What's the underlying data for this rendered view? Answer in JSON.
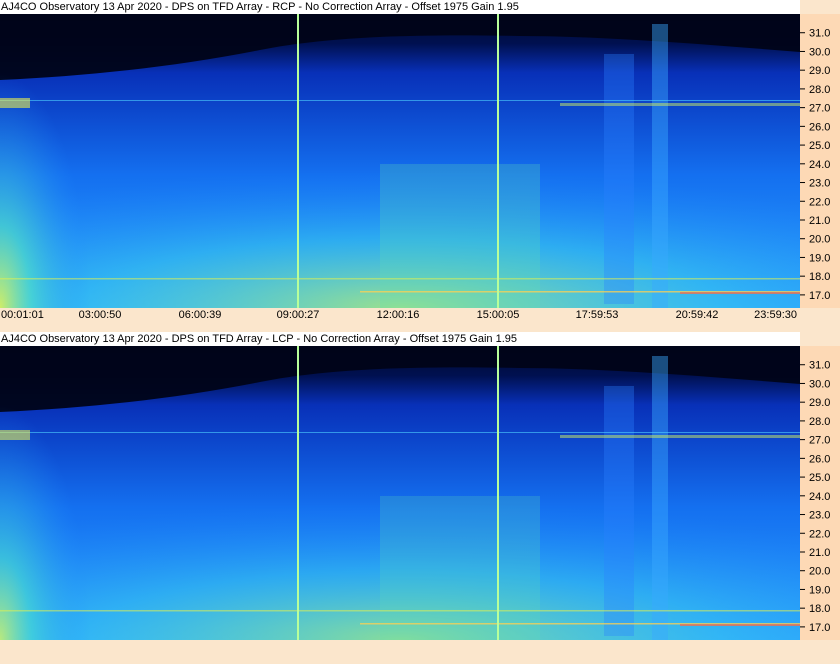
{
  "chart_data": [
    {
      "type": "heatmap",
      "title": "AJ4CO Observatory 13 Apr 2020 - DPS on TFD Array  - RCP  -  No Correction Array  -  Offset 1975  Gain 1.95",
      "x_tick_labels": [
        "00:01:01",
        "03:00:50",
        "06:00:39",
        "09:00:27",
        "12:00:16",
        "15:00:05",
        "17:59:53",
        "20:59:42",
        "23:59:30"
      ],
      "y_tick_labels": [
        "31.0",
        "30.0",
        "29.0",
        "28.0",
        "27.0",
        "26.0",
        "25.0",
        "24.0",
        "23.0",
        "22.0",
        "21.0",
        "20.0",
        "19.0",
        "18.0",
        "17.0"
      ],
      "ylim": [
        16.3,
        32.0
      ],
      "xlim": [
        "00:01:01",
        "23:59:30"
      ],
      "cursor_times": [
        "09:00:27",
        "15:00:05"
      ],
      "polarization": "RCP",
      "colormap": [
        "#000824",
        "#001a7a",
        "#0a46d6",
        "#1f8cff",
        "#3ed8e8",
        "#9ff070",
        "#ffe94a",
        "#ff5a3c"
      ]
    },
    {
      "type": "heatmap",
      "title": "AJ4CO Observatory 13 Apr 2020 - DPS on TFD Array  - LCP  -  No Correction Array  -  Offset 1975  Gain 1.95",
      "x_tick_labels": [],
      "y_tick_labels": [
        "31.0",
        "30.0",
        "29.0",
        "28.0",
        "27.0",
        "26.0",
        "25.0",
        "24.0",
        "23.0",
        "22.0",
        "21.0",
        "20.0",
        "19.0",
        "18.0",
        "17.0"
      ],
      "ylim": [
        16.3,
        32.0
      ],
      "xlim": [
        "00:01:01",
        "23:59:30"
      ],
      "cursor_times": [
        "09:00:27",
        "15:00:05"
      ],
      "polarization": "LCP",
      "colormap": [
        "#000824",
        "#001a7a",
        "#0a46d6",
        "#1f8cff",
        "#3ed8e8",
        "#9ff070",
        "#ffe94a",
        "#ff5a3c"
      ]
    }
  ],
  "colors": {
    "cursor": "#b8ff9a",
    "axis_bg": "#fdd9b5",
    "page_bg": "#fbe6cc",
    "title_bg": "#ffffff"
  }
}
